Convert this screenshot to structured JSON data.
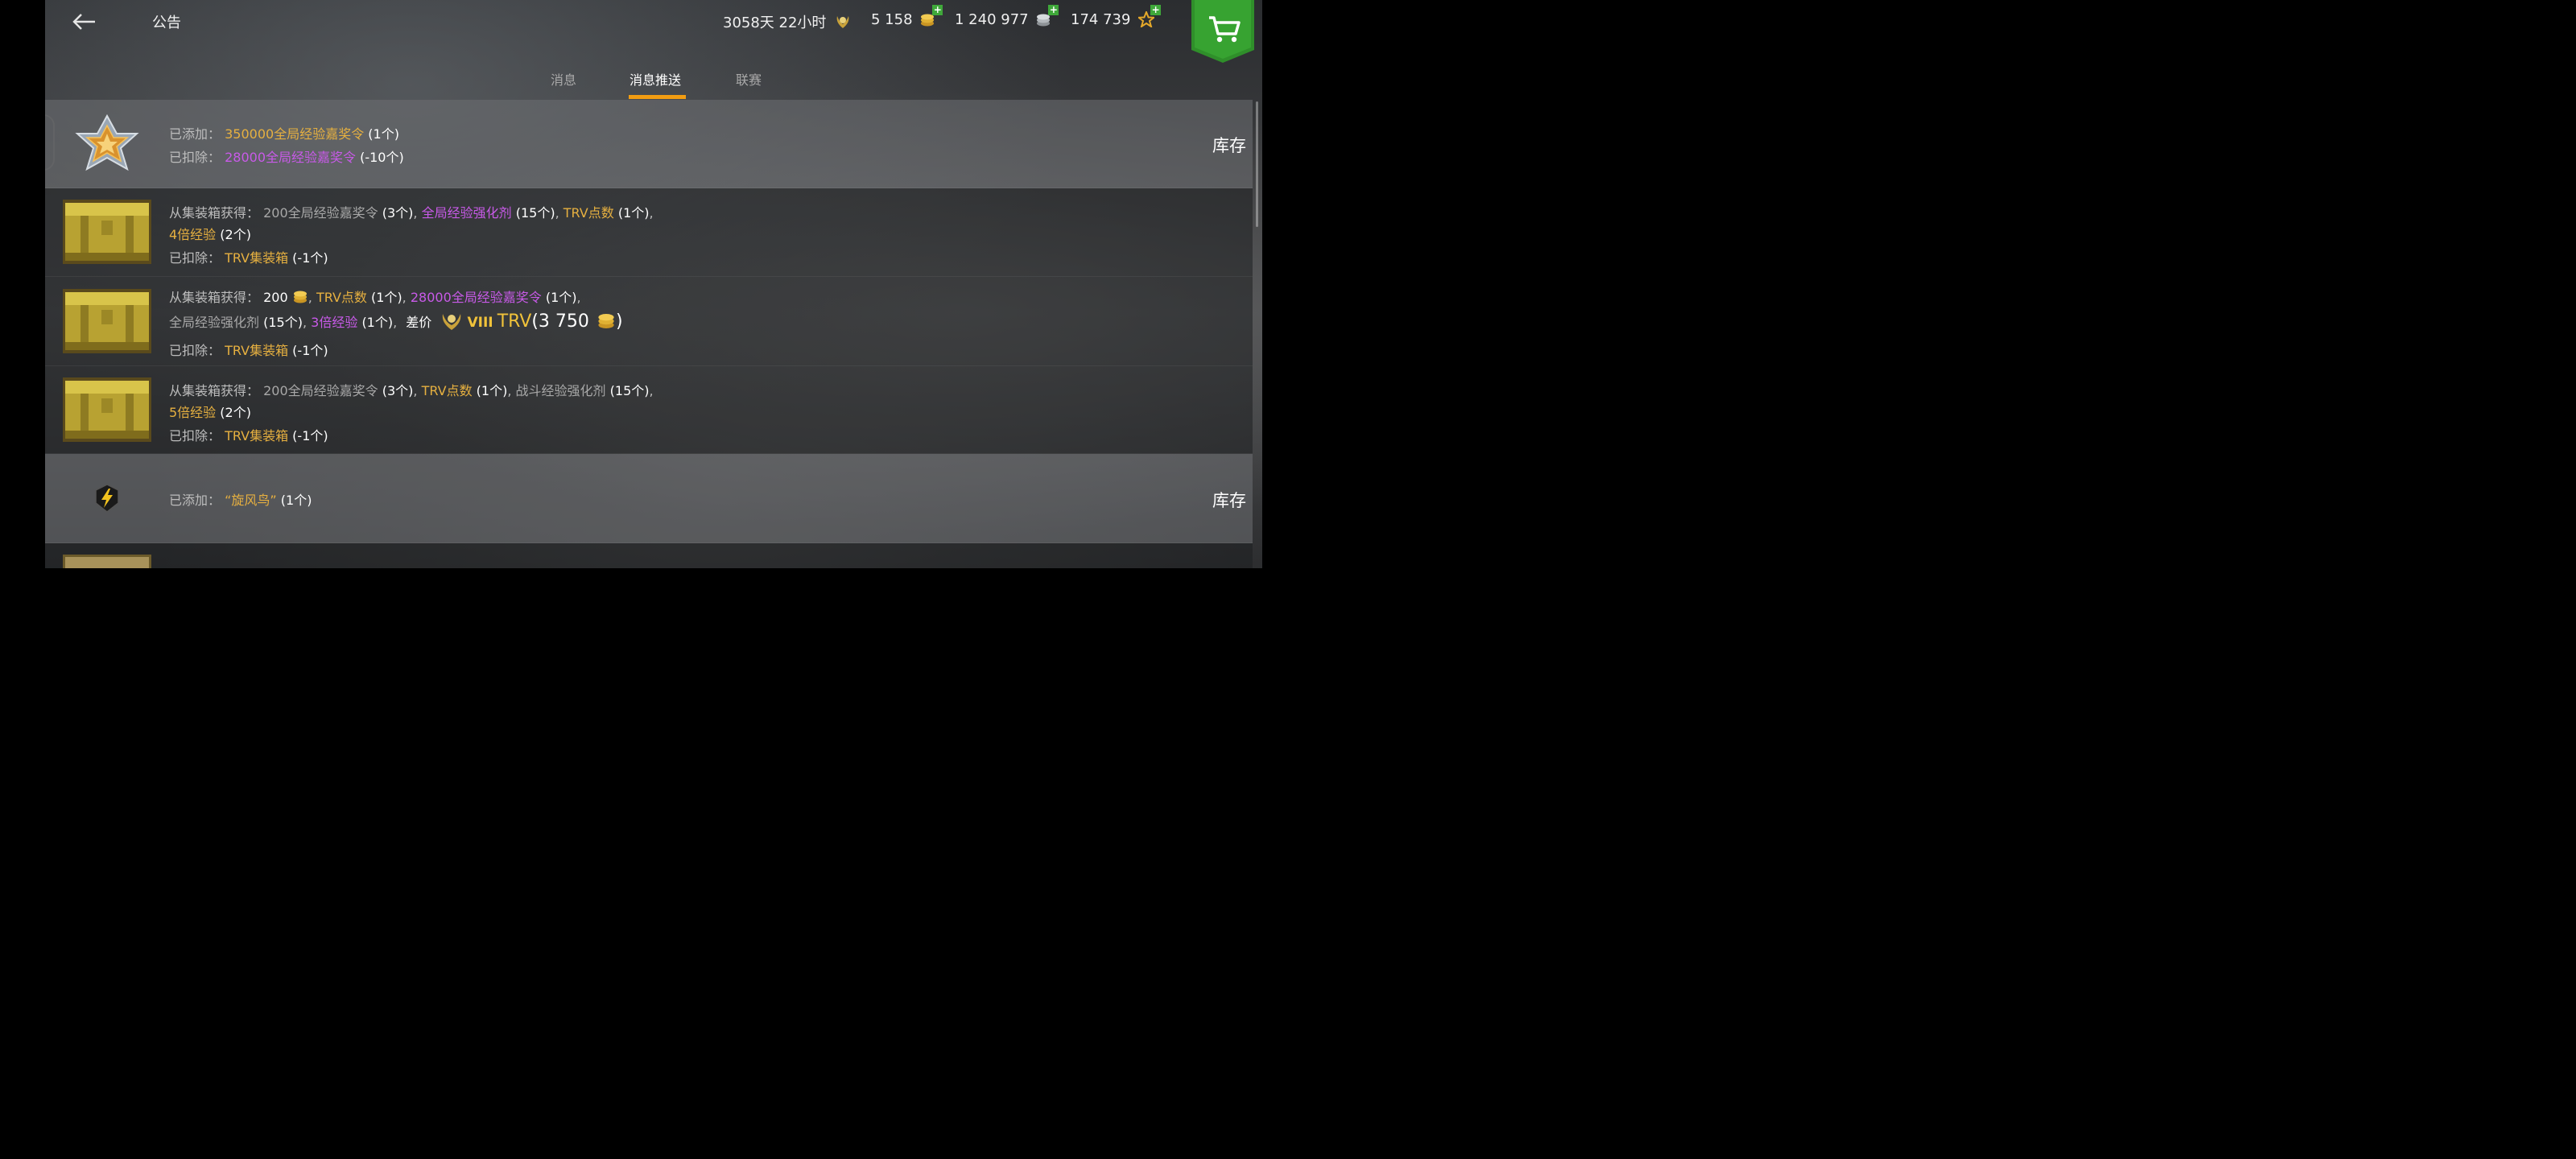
{
  "header": {
    "title": "公告",
    "stats": {
      "time": "3058天 22小时",
      "gold": "5 158",
      "credits": "1 240 977",
      "free_xp": "174 739"
    }
  },
  "tabs": [
    {
      "label": "消息"
    },
    {
      "label": "消息推送"
    },
    {
      "label": "联赛"
    }
  ],
  "rows": [
    {
      "icon": "star-badge-icon",
      "inventory_label": "库存",
      "added_label": "已添加：",
      "added_item": "350000全局经验嘉奖令",
      "added_qty": "(1个)",
      "removed_label": "已扣除：",
      "removed_item": "28000全局经验嘉奖令",
      "removed_qty": "(-10个)"
    },
    {
      "icon": "crate-icon",
      "from_label": "从集装箱获得：",
      "i1": "200全局经验嘉奖令",
      "q1": "(3个)",
      "i2": "全局经验强化剂",
      "q2": "(15个)",
      "i3": "TRV点数",
      "q3": "(1个)",
      "i4": "4倍经验",
      "q4": "(2个)",
      "removed_label": "已扣除：",
      "removed_item": "TRV集装箱",
      "removed_qty": "(-1个)"
    },
    {
      "icon": "crate-icon",
      "from_label": "从集装箱获得：",
      "i1": "200",
      "q1": "",
      "i2": "TRV点数",
      "q2": "(1个)",
      "i3": "28000全局经验嘉奖令",
      "q3": "(1个)",
      "i4": "全局经验强化剂",
      "q4": "(15个)",
      "i5": "3倍经验",
      "q5": "(1个)",
      "diff_label": "差价",
      "tier": "VIII",
      "tank": "TRV",
      "diff_value": "3 750",
      "removed_label": "已扣除：",
      "removed_item": "TRV集装箱",
      "removed_qty": "(-1个)"
    },
    {
      "icon": "crate-icon",
      "from_label": "从集装箱获得：",
      "i1": "200全局经验嘉奖令",
      "q1": "(3个)",
      "i2": "TRV点数",
      "q2": "(1个)",
      "i3": "战斗经验强化剂",
      "q3": "(15个)",
      "i4": "5倍经验",
      "q4": "(2个)",
      "removed_label": "已扣除：",
      "removed_item": "TRV集装箱",
      "removed_qty": "(-1个)"
    },
    {
      "icon": "lightning-shield-icon",
      "inventory_label": "库存",
      "added_label": "已添加：",
      "added_item": "“旋风鸟”",
      "added_qty": "(1个)"
    }
  ],
  "colors": {
    "accent": "#f29d12",
    "gold_text": "#e6b040",
    "purple_text": "#c85ae8",
    "shop_green": "#2f8f2a"
  }
}
